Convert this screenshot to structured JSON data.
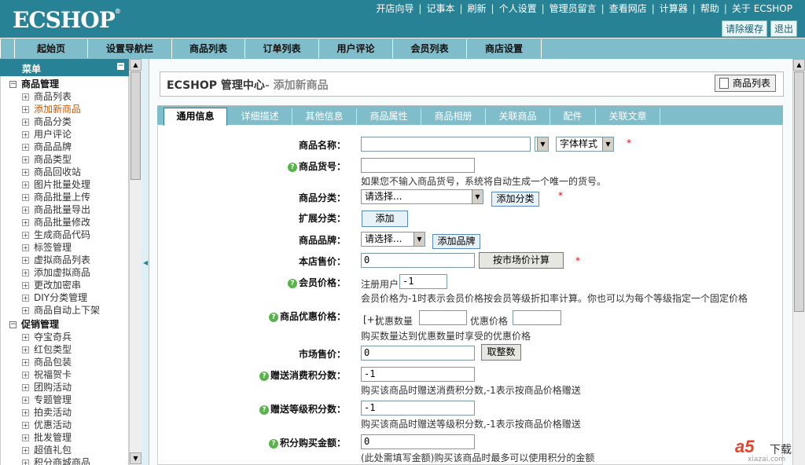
{
  "app": {
    "logo": "ECSHOP"
  },
  "top_links": [
    "开店向导",
    "记事本",
    "刷新",
    "个人设置",
    "管理员留言",
    "查看网店",
    "计算器",
    "帮助",
    "关于 ECSHOP"
  ],
  "top_buttons": {
    "clear_cache": "请除缓存",
    "logout": "退出"
  },
  "nav_tabs": [
    "起始页",
    "设置导航栏",
    "商品列表",
    "订单列表",
    "用户评论",
    "会员列表",
    "商店设置"
  ],
  "menu": {
    "title": "菜单",
    "collapse_glyph": "−",
    "categories": [
      {
        "name": "商品管理",
        "glyph": "⊟",
        "items": [
          "商品列表",
          "添加新商品",
          "商品分类",
          "用户评论",
          "商品品牌",
          "商品类型",
          "商品回收站",
          "图片批量处理",
          "商品批量上传",
          "商品批量导出",
          "商品批量修改",
          "生成商品代码",
          "标签管理",
          "虚拟商品列表",
          "添加虚拟商品",
          "更改加密串",
          "DIY分类管理",
          "商品自动上下架"
        ]
      },
      {
        "name": "促销管理",
        "glyph": "⊟",
        "items": [
          "夺宝奇兵",
          "红包类型",
          "商品包装",
          "祝福贺卡",
          "团购活动",
          "专题管理",
          "拍卖活动",
          "优惠活动",
          "批发管理",
          "超值礼包",
          "积分商城商品"
        ]
      }
    ],
    "active_item": "添加新商品"
  },
  "header": {
    "title": "ECSHOP 管理中心",
    "subtitle": "- 添加新商品",
    "list_button": "商品列表"
  },
  "form_tabs": [
    "通用信息",
    "详细描述",
    "其他信息",
    "商品属性",
    "商品相册",
    "关联商品",
    "配件",
    "关联文章"
  ],
  "form": {
    "goods_name": {
      "label": "商品名称：",
      "value": "",
      "font_style": "字体样式",
      "required": "*"
    },
    "goods_sn": {
      "label": "商品货号：",
      "value": "",
      "note": "如果您不输入商品货号，系统将自动生成一个唯一的货号。"
    },
    "category": {
      "label": "商品分类：",
      "value": "请选择...",
      "button": "添加分类",
      "required": "*"
    },
    "ext_category": {
      "label": "扩展分类：",
      "button": "添加"
    },
    "brand": {
      "label": "商品品牌：",
      "value": "请选择...",
      "button": "添加品牌"
    },
    "shop_price": {
      "label": "本店售价：",
      "value": "0",
      "button": "按市场价计算",
      "required": "*"
    },
    "member_price": {
      "label": "会员价格：",
      "rank": "注册用户",
      "value": "-1",
      "note": "会员价格为-1时表示会员价格按会员等级折扣率计算。你也可以为每个等级指定一个固定价格"
    },
    "volume_price": {
      "label": "商品优惠价格：",
      "toggle": "[+]",
      "qty_label": "优惠数量",
      "price_label": "优惠价格",
      "qty": "",
      "price": "",
      "note": "购买数量达到优惠数量时享受的优惠价格"
    },
    "market_price": {
      "label": "市场售价：",
      "value": "0",
      "button": "取整数"
    },
    "give_integral": {
      "label": "赠送消费积分数：",
      "value": "-1",
      "note": "购买该商品时赠送消费积分数,-1表示按商品价格赠送"
    },
    "rank_integral": {
      "label": "赠送等级积分数：",
      "value": "-1",
      "note": "购买该商品时赠送等级积分数,-1表示按商品价格赠送"
    },
    "integral": {
      "label": "积分购买金额：",
      "value": "0",
      "note": "(此处需填写金额)购买该商品时最多可以使用积分的金额"
    }
  },
  "watermark": {
    "main": "a5",
    "sub": "下载",
    "url": "xiazai.com"
  },
  "colors": {
    "brand": "#278296",
    "nav": "#80bdcb",
    "required": "#e00000",
    "help": "#58b44a",
    "active_menu": "#d05a00"
  }
}
